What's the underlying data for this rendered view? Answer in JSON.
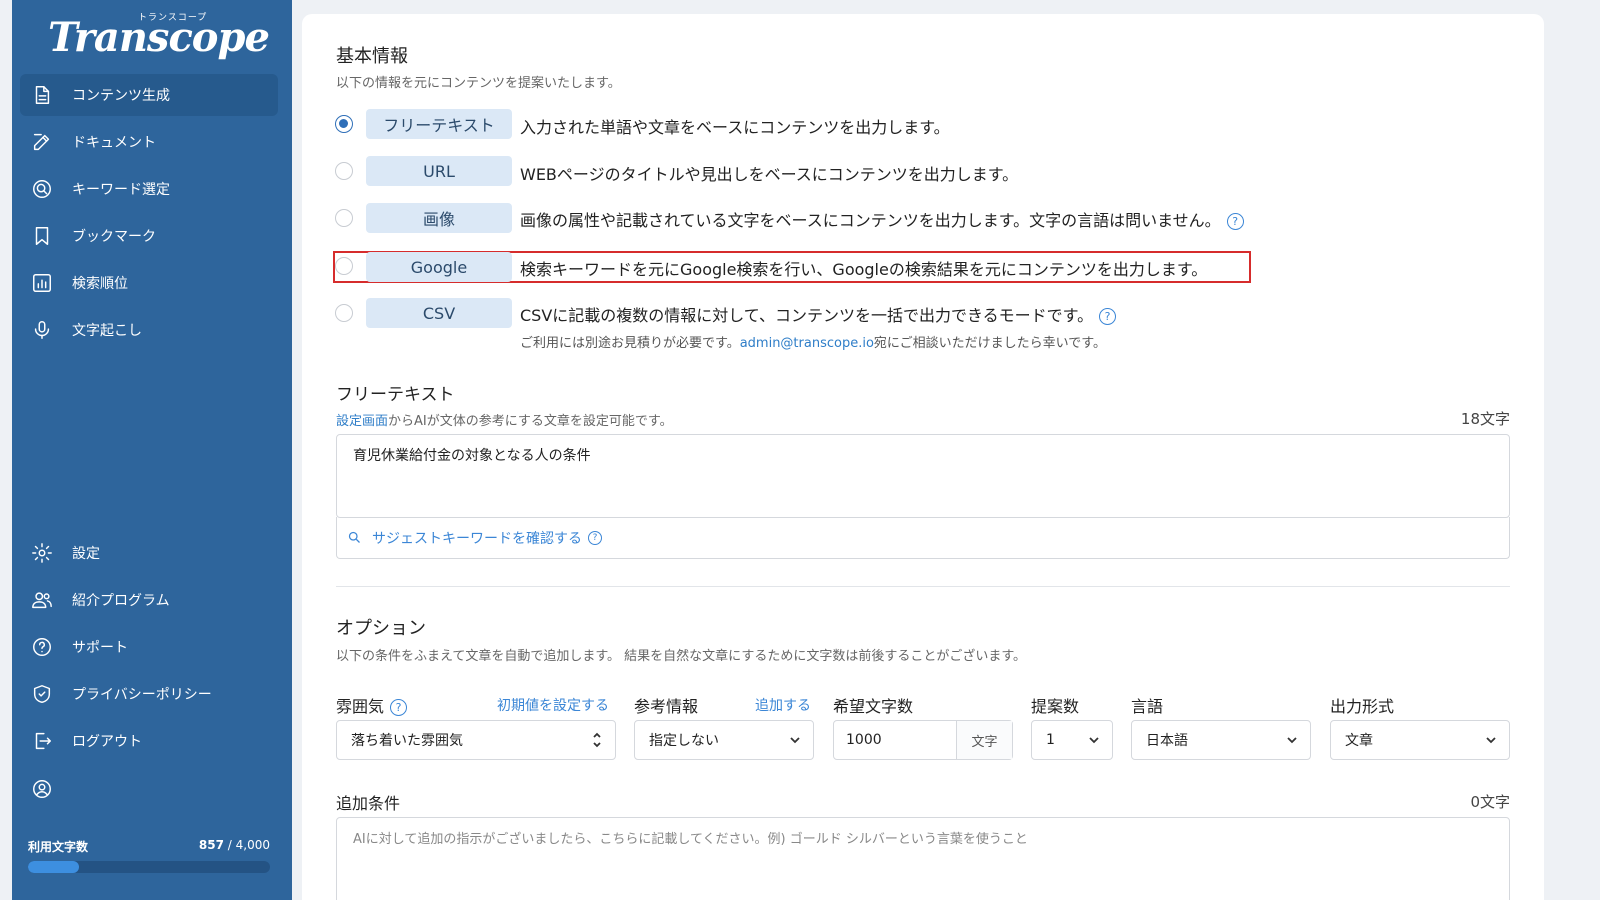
{
  "sidebar": {
    "logo_text": "Transcope",
    "logo_kana": "トランスコープ",
    "nav": [
      {
        "label": "コンテンツ生成",
        "icon": "document-icon"
      },
      {
        "label": "ドキュメント",
        "icon": "edit-icon"
      },
      {
        "label": "キーワード選定",
        "icon": "search-keyword-icon"
      },
      {
        "label": "ブックマーク",
        "icon": "bookmark-icon"
      },
      {
        "label": "検索順位",
        "icon": "chart-icon"
      },
      {
        "label": "文字起こし",
        "icon": "microphone-icon"
      }
    ],
    "bottom_nav": [
      {
        "label": "設定",
        "icon": "gear-icon"
      },
      {
        "label": "紹介プログラム",
        "icon": "users-icon"
      },
      {
        "label": "サポート",
        "icon": "help-icon"
      },
      {
        "label": "プライバシーポリシー",
        "icon": "shield-icon"
      },
      {
        "label": "ログアウト",
        "icon": "logout-icon"
      }
    ],
    "usage_label": "利用文字数",
    "usage_used": "857",
    "usage_total": " / 4,000",
    "usage_fraction": 0.21
  },
  "basic": {
    "title": "基本情報",
    "subtitle": "以下の情報を元にコンテンツを提案いたします。",
    "modes": [
      {
        "tag": "フリーテキスト",
        "desc": "入力された単語や文章をベースにコンテンツを出力します。",
        "checked": true
      },
      {
        "tag": "URL",
        "desc": "WEBページのタイトルや見出しをベースにコンテンツを出力します。",
        "checked": false
      },
      {
        "tag": "画像",
        "desc": "画像の属性や記載されている文字をベースにコンテンツを出力します。文字の言語は問いません。",
        "checked": false
      },
      {
        "tag": "Google",
        "desc": "検索キーワードを元にGoogle検索を行い、Googleの検索結果を元にコンテンツを出力します。",
        "checked": false
      },
      {
        "tag": "CSV",
        "desc": "CSVに記載の複数の情報に対して、コンテンツを一括で出力できるモードです。",
        "checked": false
      }
    ],
    "csv_note_pre": "ご利用には別途お見積りが必要です。",
    "csv_note_email": "admin@transcope.io",
    "csv_note_post": "宛にご相談いただけましたら幸いです。"
  },
  "freetext": {
    "title": "フリーテキスト",
    "hint_link": "設定画面",
    "hint_rest": "からAIが文体の参考にする文章を設定可能です。",
    "count": "18文字",
    "value": "育児休業給付金の対象となる人の条件",
    "suggest_label": "サジェストキーワードを確認する"
  },
  "options": {
    "title": "オプション",
    "subtitle": "以下の条件をふまえて文章を自動で追加します。 結果を自然な文章にするために文字数は前後することがございます。",
    "mood_label": "雰囲気",
    "mood_link": "初期値を設定する",
    "mood_value": "落ち着いた雰囲気",
    "ref_label": "参考情報",
    "ref_link": "追加する",
    "ref_value": "指定しない",
    "length_label": "希望文字数",
    "length_value": "1000",
    "length_unit": "文字",
    "count_label": "提案数",
    "count_value": "1",
    "lang_label": "言語",
    "lang_value": "日本語",
    "format_label": "出力形式",
    "format_value": "文章",
    "extra_label": "追加条件",
    "extra_count": "0文字",
    "extra_placeholder": "AIに対して追加の指示がございましたら、こちらに記載してください。例) ゴールド シルバーという言葉を使うこと"
  }
}
